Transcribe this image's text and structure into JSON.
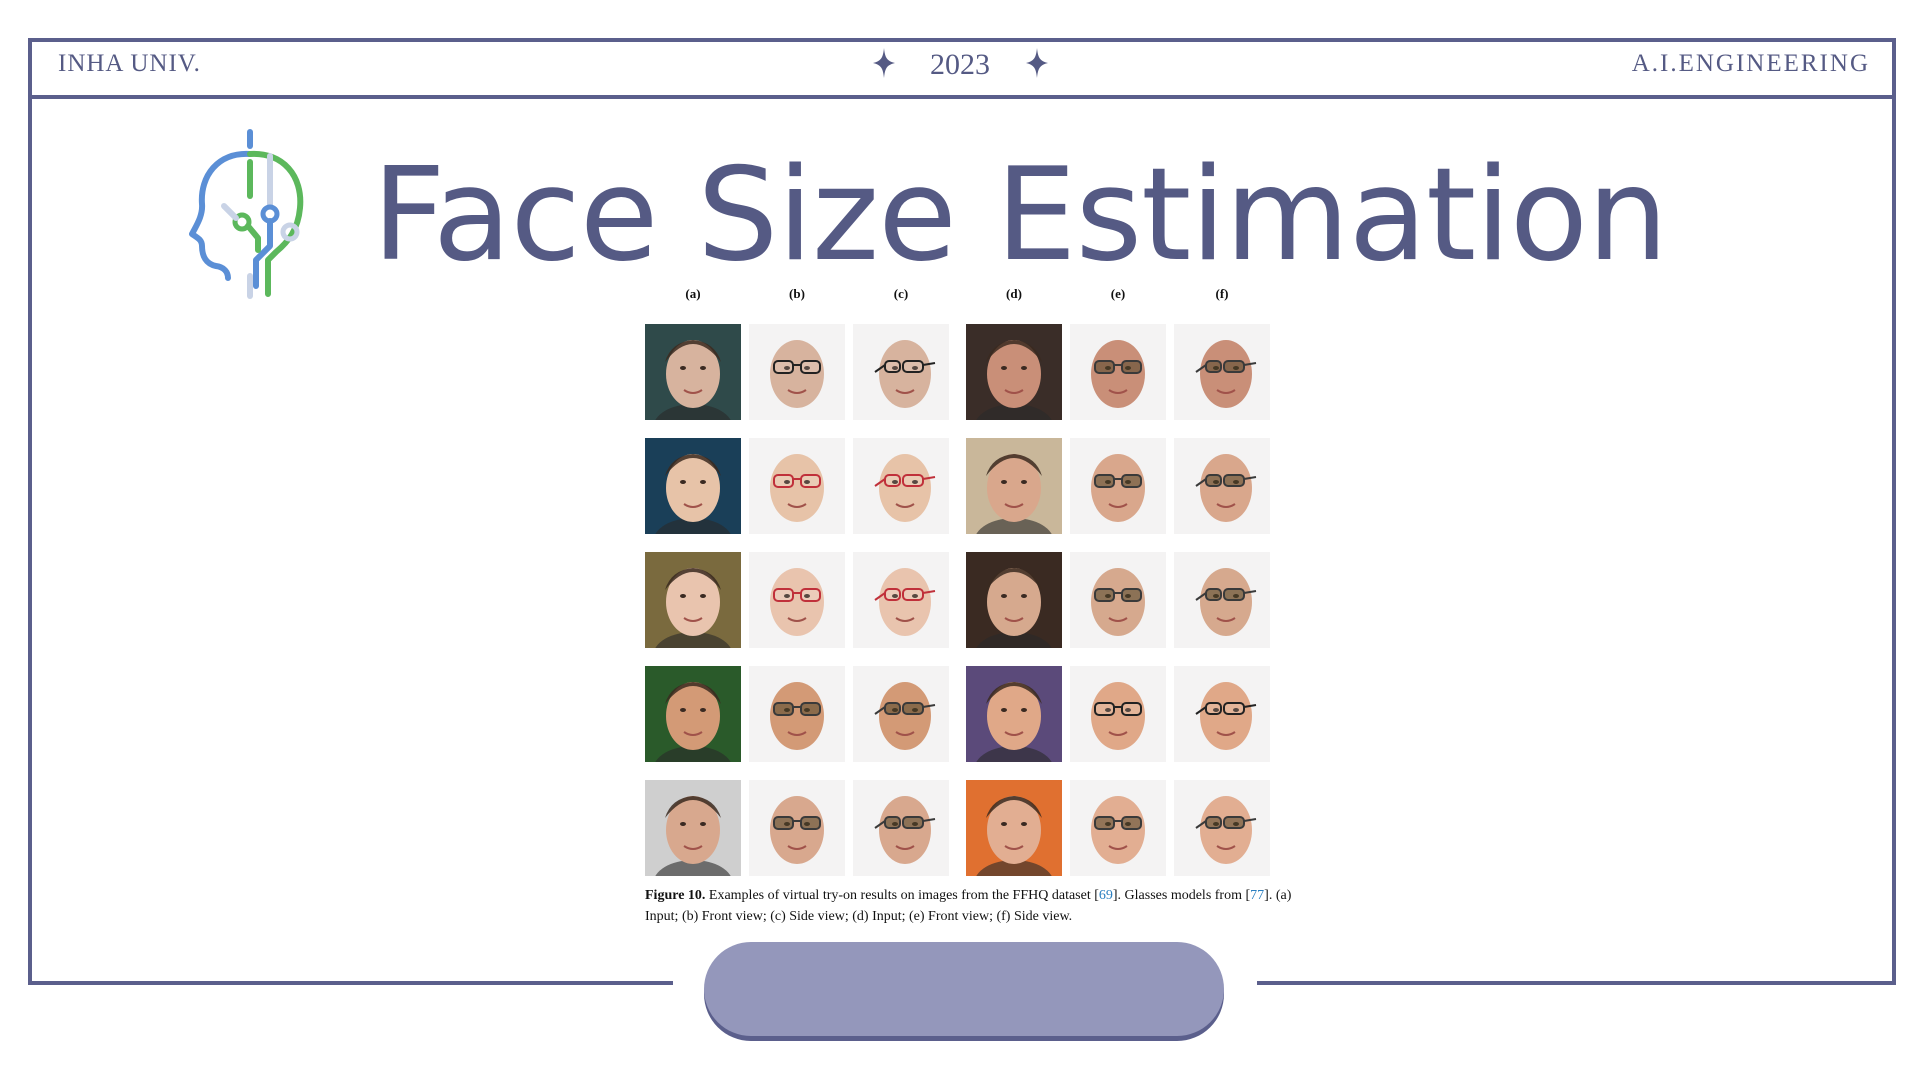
{
  "header": {
    "left": "INHA UNIV.",
    "center": "2023",
    "right": "A.I.ENGINEERING"
  },
  "title": "Face Size Estimation",
  "logo": {
    "icon": "ai-head-circuit-icon",
    "colors": [
      "#5b8fd6",
      "#5cb85c",
      "#c9d3e6"
    ]
  },
  "figure": {
    "column_labels": [
      "(a)",
      "(b)",
      "(c)",
      "(d)",
      "(e)",
      "(f)"
    ],
    "caption": {
      "label": "Figure 10.",
      "text_1": " Examples of virtual try-on results on images from the FFHQ dataset [",
      "ref_1": "69",
      "text_2": "]. Glasses models from [",
      "ref_2": "77",
      "text_3": "]. (a) Input; (b) Front view; (c) Side view; (d) Input; (e) Front view; (f) Side view."
    },
    "rows": [
      {
        "input_a_bg": "#2f4a4a",
        "input_d_bg": "#3a2d28",
        "skin_a": "#d7b39e",
        "skin_d": "#c98f78",
        "glasses_b": "clear",
        "glasses_e": "tinted"
      },
      {
        "input_a_bg": "#1a3f58",
        "input_d_bg": "#c9b79a",
        "skin_a": "#e7c3a8",
        "skin_d": "#d9a78c",
        "glasses_b": "red",
        "glasses_e": "tinted"
      },
      {
        "input_a_bg": "#7a6a3e",
        "input_d_bg": "#3a2a22",
        "skin_a": "#e9c4ae",
        "skin_d": "#d6a98e",
        "glasses_b": "red",
        "glasses_e": "tinted"
      },
      {
        "input_a_bg": "#2a5a2a",
        "input_d_bg": "#5b4a7a",
        "skin_a": "#d39a76",
        "skin_d": "#e0a888",
        "glasses_b": "tinted",
        "glasses_e": "clear"
      },
      {
        "input_a_bg": "#cfcfcf",
        "input_d_bg": "#e07030",
        "skin_a": "#d8a88e",
        "skin_d": "#e2ae92",
        "glasses_b": "tinted",
        "glasses_e": "tinted"
      }
    ]
  },
  "colors": {
    "accent": "#555a84",
    "border": "#5b5f8c",
    "pill": "#9497bb"
  }
}
